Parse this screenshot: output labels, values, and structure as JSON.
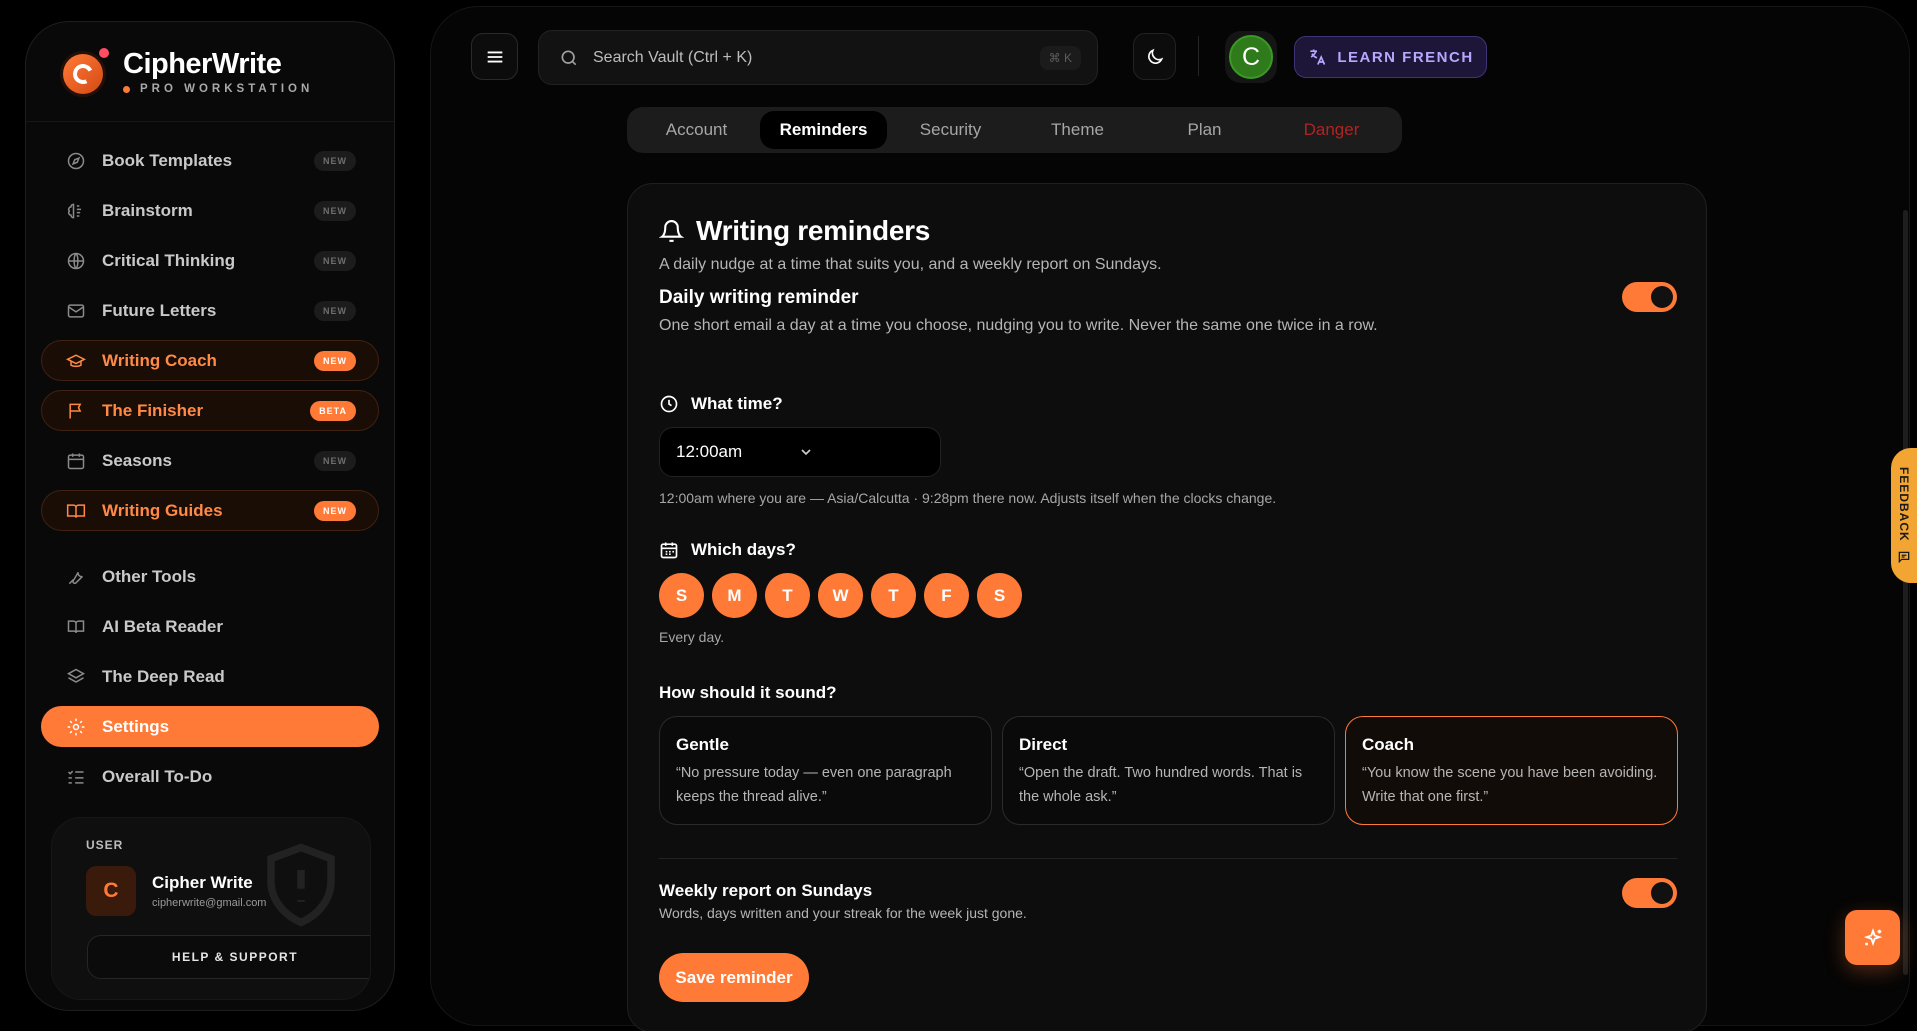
{
  "brand": {
    "name": "CipherWrite",
    "tagline": "PRO WORKSTATION",
    "accent": "#ff7a36"
  },
  "sidebar": {
    "items": [
      {
        "label": "Book Templates",
        "badge": "NEW",
        "icon": "compass-icon"
      },
      {
        "label": "Brainstorm",
        "badge": "NEW",
        "icon": "brain-icon"
      },
      {
        "label": "Critical Thinking",
        "badge": "NEW",
        "icon": "globe-icon"
      },
      {
        "label": "Future Letters",
        "badge": "NEW",
        "icon": "mail-icon"
      },
      {
        "label": "Writing Coach",
        "badge": "NEW",
        "icon": "graduation-cap-icon"
      },
      {
        "label": "The Finisher",
        "badge": "BETA",
        "icon": "flag-icon"
      },
      {
        "label": "Seasons",
        "badge": "NEW",
        "icon": "calendar-icon"
      },
      {
        "label": "Writing Guides",
        "badge": "NEW",
        "icon": "book-open-icon"
      },
      {
        "label": "Other Tools",
        "badge": "",
        "icon": "wrench-icon"
      },
      {
        "label": "AI Beta Reader",
        "badge": "",
        "icon": "book-reader-icon"
      },
      {
        "label": "The Deep Read",
        "badge": "",
        "icon": "layers-icon"
      },
      {
        "label": "Settings",
        "badge": "",
        "icon": "gear-icon"
      },
      {
        "label": "Overall To-Do",
        "badge": "",
        "icon": "list-check-icon"
      }
    ]
  },
  "user": {
    "label": "USER",
    "initial": "C",
    "name": "Cipher Write",
    "email": "cipherwrite@gmail.com",
    "help_label": "HELP & SUPPORT"
  },
  "header": {
    "search_placeholder": "Search Vault (Ctrl + K)",
    "search_shortcut": "⌘ K",
    "profile_initial": "C",
    "learn_label": "LEARN FRENCH"
  },
  "tabs": [
    "Account",
    "Reminders",
    "Security",
    "Theme",
    "Plan",
    "Danger"
  ],
  "reminders": {
    "title": "Writing reminders",
    "description": "A daily nudge at a time that suits you, and a weekly report on Sundays.",
    "daily": {
      "title": "Daily writing reminder",
      "description": "One short email a day at a time you choose, nudging you to write. Never the same one twice in a row.",
      "enabled": true
    },
    "time_label": "What time?",
    "time_value": "12:00am",
    "time_note": "12:00am where you are — Asia/Calcutta · 9:28pm there now. Adjusts itself when the clocks change.",
    "days_label": "Which days?",
    "days": [
      "S",
      "M",
      "T",
      "W",
      "T",
      "F",
      "S"
    ],
    "days_note": "Every day.",
    "tone_label": "How should it sound?",
    "tones": [
      {
        "name": "Gentle",
        "quote": "“No pressure today — even one paragraph keeps the thread alive.”"
      },
      {
        "name": "Direct",
        "quote": "“Open the draft. Two hundred words. That is the whole ask.”"
      },
      {
        "name": "Coach",
        "quote": "“You know the scene you have been avoiding. Write that one first.”"
      }
    ],
    "weekly": {
      "title": "Weekly report on Sundays",
      "description": "Words, days written and your streak for the week just gone.",
      "enabled": true
    },
    "save_label": "Save reminder"
  },
  "feedback_label": "FEEDBACK"
}
